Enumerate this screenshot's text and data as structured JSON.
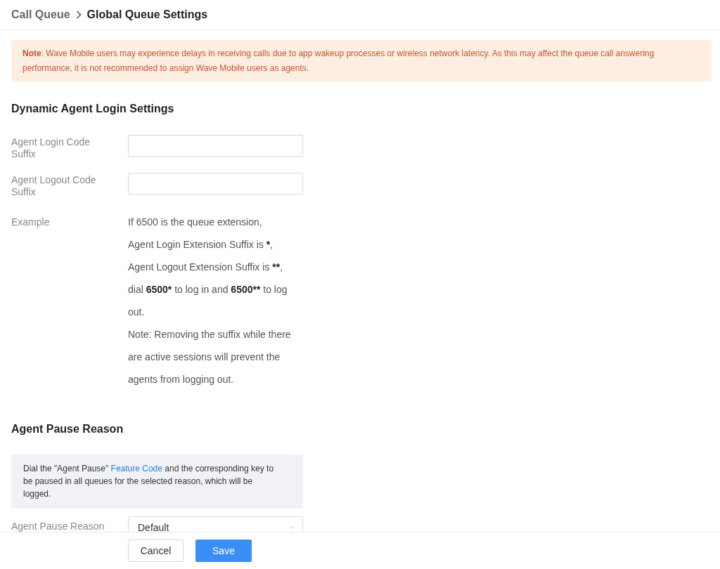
{
  "breadcrumb": {
    "parent": "Call Queue",
    "current": "Global Queue Settings"
  },
  "notice": {
    "text": "**Note**: Wave Mobile users may experience delays in receiving calls due to app wakeup processes or wireless network latency. As this may affect the queue call answering performance, it is not recommended to assign Wave Mobile users as agents."
  },
  "sections": [
    {
      "title": "Dynamic Agent Login Settings",
      "rows": [
        {
          "kind": "input",
          "label": "Agent Login Code Suffix"
        },
        {
          "kind": "input",
          "label": "Agent Logout Code Suffix"
        },
        {
          "kind": "example",
          "label": "Example",
          "paragraphs": [
            [
              {
                "kind": "plain",
                "text": "If 6500 is the queue extension,"
              }
            ],
            [
              {
                "kind": "plain",
                "text": "Agent Login Extension Suffix is "
              },
              {
                "kind": "strong",
                "text": "*"
              },
              {
                "kind": "plain",
                "text": ","
              }
            ],
            [
              {
                "kind": "plain",
                "text": "Agent Logout Extension Suffix is "
              },
              {
                "kind": "strong",
                "text": "**"
              },
              {
                "kind": "plain",
                "text": ","
              }
            ],
            [
              {
                "kind": "plain",
                "text": "dial "
              },
              {
                "kind": "strong",
                "text": "6500*"
              },
              {
                "kind": "plain",
                "text": " to log in and "
              },
              {
                "kind": "strong",
                "text": "6500**"
              },
              {
                "kind": "plain",
                "text": " to log out."
              }
            ],
            [
              {
                "kind": "plain",
                "text": "Note: Removing the suffix while there are active sessions will prevent the agents from logging out."
              }
            ]
          ]
        }
      ]
    },
    {
      "title": "Agent Pause Reason",
      "info": [
        {
          "kind": "text",
          "text": "Dial the \"Agent Pause\" "
        },
        {
          "kind": "link",
          "text": "Feature Code"
        },
        {
          "kind": "text",
          "text": " and the corresponding key to be paused in all queues for the selected reason, which will be logged."
        }
      ],
      "rows": [
        {
          "kind": "select",
          "label": "Agent Pause Reason",
          "value": "Default"
        }
      ]
    }
  ],
  "buttons": [
    {
      "label": "Cancel",
      "kind": "secondary"
    },
    {
      "label": "Save",
      "kind": "primary"
    }
  ]
}
